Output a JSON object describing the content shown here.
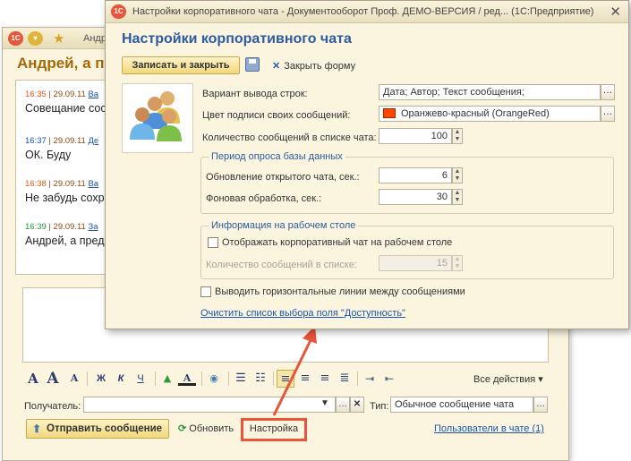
{
  "back_window": {
    "title_partial": "Андр",
    "heading_partial": "Андрей, а п",
    "messages": [
      {
        "time": "16:35",
        "date": "29.09.11",
        "author_partial": "Ва",
        "text": "Совещание сос",
        "time_color": "#e05a1a"
      },
      {
        "time": "16:37",
        "date": "29.09.11",
        "author_partial": "Де",
        "text": "ОК. Буду",
        "time_color": "#1a55b0"
      },
      {
        "time": "16:38",
        "date": "29.09.11",
        "author_partial": "Ва",
        "text": "Не забудь сохр",
        "time_color": "#e05a1a"
      },
      {
        "time": "16:39",
        "date": "29.09.11",
        "author_partial": "За",
        "text": "Андрей, а пред",
        "time_color": "#2a9a3a"
      }
    ],
    "toolbar": {
      "bold": "Ж",
      "italic": "К",
      "underline": "Ч",
      "all_actions": "Все действия ▾"
    },
    "recipient_label": "Получатель:",
    "recipient_value": "",
    "type_label": "Тип:",
    "type_value": "Обычное сообщение чата",
    "send_button": "Отправить сообщение",
    "refresh_button": "Обновить",
    "settings_button": "Настройка",
    "users_link": "Пользователи в чате (1)"
  },
  "settings_window": {
    "title": "Настройки корпоративного чата - Документооборот Проф. ДЕМО-ВЕРСИЯ / ред... (1С:Предприятие)",
    "heading": "Настройки корпоративного чата",
    "save_close_button": "Записать и закрыть",
    "close_form_button": "Закрыть форму",
    "rows": {
      "output_variant": {
        "label": "Вариант вывода строк:",
        "value": "Дата; Автор; Текст сообщения;"
      },
      "own_color": {
        "label": "Цвет подписи своих сообщений:",
        "value": "Оранжево-красный (OrangeRed)",
        "swatch": "#ff4500"
      },
      "message_count": {
        "label": "Количество сообщений в списке чата:",
        "value": "100"
      }
    },
    "polling_group": {
      "title": "Период опроса базы данных",
      "open_chat_label": "Обновление открытого чата, сек.:",
      "open_chat_value": "6",
      "background_label": "Фоновая обработка, сек.:",
      "background_value": "30"
    },
    "desktop_group": {
      "title": "Информация на рабочем столе",
      "show_checkbox_label": "Отображать корпоративный чат на рабочем столе",
      "show_checked": false,
      "count_label": "Количество сообщений в списке:",
      "count_value": "15"
    },
    "horizontal_lines_label": "Выводить горизонтальные линии между сообщениями",
    "horizontal_lines_checked": false,
    "clear_link": "Очистить список выбора поля \"Доступность\""
  },
  "colors": {
    "accent_orange": "#e8553a",
    "heading_blue": "#2d5aa0",
    "window_bg": "#fbf5df"
  }
}
